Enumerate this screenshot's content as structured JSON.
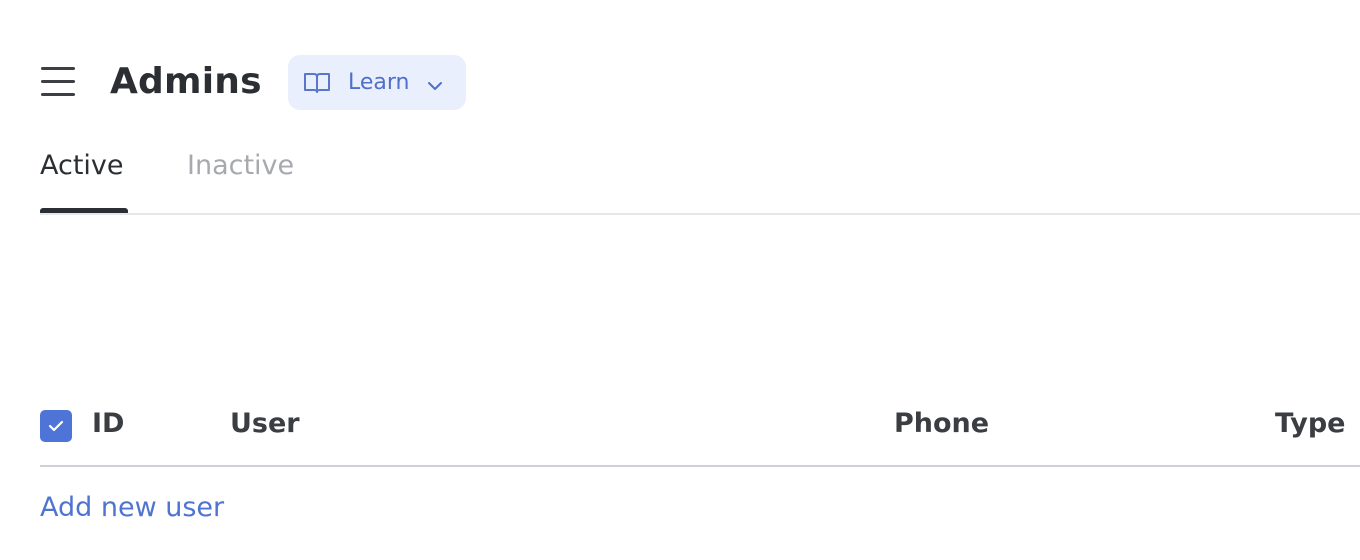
{
  "header": {
    "title": "Admins",
    "menu_icon": "hamburger-menu-icon",
    "learn_button": {
      "label": "Learn",
      "icon": "book-icon",
      "dropdown_icon": "chevron-down-icon"
    }
  },
  "tabs": [
    {
      "label": "Active",
      "selected": true
    },
    {
      "label": "Inactive",
      "selected": false
    }
  ],
  "table": {
    "select_all_checked": true,
    "columns": [
      "ID",
      "User",
      "Phone",
      "Type"
    ]
  },
  "add_user_label": "Add new user",
  "colors": {
    "accent": "#4d74d6",
    "learn_bg": "#e9effc",
    "text_dark": "#2b2e33",
    "text_muted": "#a7a9ae"
  }
}
